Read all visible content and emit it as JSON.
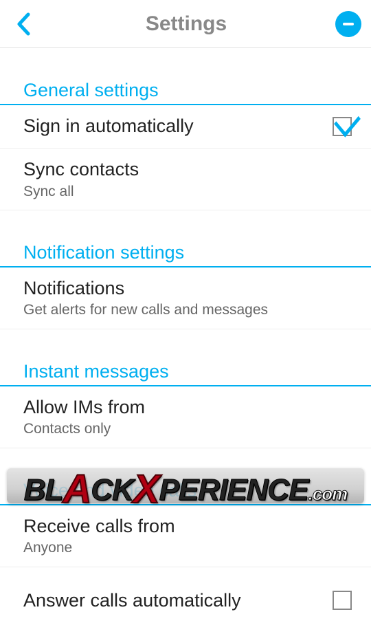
{
  "header": {
    "title": "Settings"
  },
  "sections": {
    "general": {
      "header": "General settings",
      "sign_in": {
        "title": "Sign in automatically",
        "checked": true
      },
      "sync_contacts": {
        "title": "Sync contacts",
        "sub": "Sync all"
      }
    },
    "notifications": {
      "header": "Notification settings",
      "notifications": {
        "title": "Notifications",
        "sub": "Get alerts for new calls and messages"
      }
    },
    "im": {
      "header": "Instant messages",
      "allow_from": {
        "title": "Allow IMs from",
        "sub": "Contacts only"
      }
    },
    "voice": {
      "header": "Voice and video calls",
      "receive_from": {
        "title": "Receive calls from",
        "sub": "Anyone"
      },
      "answer_auto": {
        "title": "Answer calls automatically",
        "checked": false
      }
    }
  },
  "watermark": {
    "prefix": "BL",
    "x": "A",
    "middle": "CK",
    "x2": "X",
    "suffix": "PERIENCE",
    "tld": ".com"
  }
}
